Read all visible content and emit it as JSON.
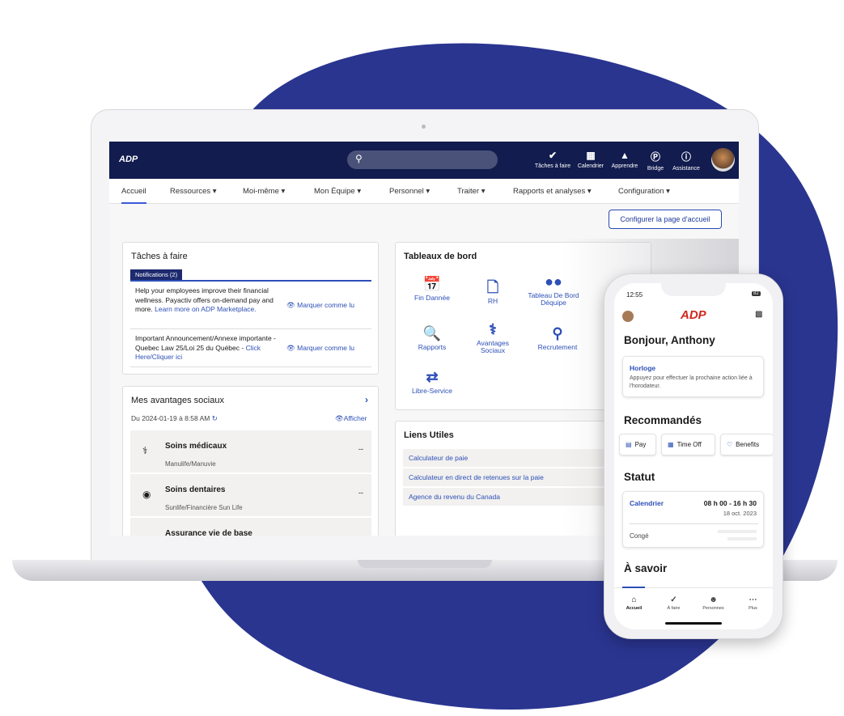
{
  "colors": {
    "brand_blue": "#2a3590",
    "topbar": "#121c4e",
    "link": "#2d4fb7",
    "adp_red": "#d0271d"
  },
  "topbar": {
    "logo": "ADP",
    "search_icon": "search-icon",
    "icons": [
      {
        "label": "Tâches à faire",
        "icon": "check-badge-icon"
      },
      {
        "label": "Calendrier",
        "icon": "calendar-icon"
      },
      {
        "label": "Apprendre",
        "icon": "graduation-cap-icon"
      },
      {
        "label": "Bridge",
        "icon": "bridge-icon"
      },
      {
        "label": "Assistance",
        "icon": "help-bubble-icon"
      }
    ]
  },
  "nav": [
    "Accueil",
    "Ressources ▾",
    "Moi-même ▾",
    "Mon Équipe ▾",
    "Personnel ▾",
    "Traiter ▾",
    "Rapports et analyses ▾",
    "Configuration ▾"
  ],
  "configure_button": "Configurer la page d'accueil",
  "tasks": {
    "title": "Tâches à faire",
    "tab": "Notifications (2)",
    "items": [
      {
        "text": "Help your employees improve their financial wellness. Payactiv offers on-demand pay and more.",
        "link": "Learn more on ADP Marketplace.",
        "action": "Marquer comme lu"
      },
      {
        "text": "Important Announcement/Annexe importante - Quebec Law 25/Loi 25 du Québec -",
        "link": "Click Here/Cliquer ici",
        "action": "Marquer comme lu"
      }
    ]
  },
  "benefits": {
    "title": "Mes avantages sociaux",
    "date": "Du 2024-01-19 à 8:58 AM",
    "view": "Afficher",
    "items": [
      {
        "title": "Soins médicaux",
        "provider": "Manulife/Manuvie",
        "value": "--"
      },
      {
        "title": "Soins dentaires",
        "provider": "Sunlife/Financière Sun Life",
        "value": "--"
      },
      {
        "title": "Assurance vie de base",
        "provider": "",
        "value": ""
      }
    ]
  },
  "dashboards": {
    "title": "Tableaux de bord",
    "tiles": [
      "Fin Dannée",
      "RH",
      "Tableau De Bord Déquipe",
      "Rapports",
      "Avantages Sociaux",
      "Recrutement",
      "Libre-Service"
    ]
  },
  "links": {
    "title": "Liens Utiles",
    "items": [
      "Calculateur de paie",
      "Calculateur en direct de retenues sur la paie",
      "Agence du revenu du Canada"
    ]
  },
  "phone": {
    "time": "12:55",
    "battery": "82",
    "logo": "ADP",
    "greeting": "Bonjour, Anthony",
    "clock": {
      "title": "Horloge",
      "text": "Appuyez pour effectuer la prochaine action liée à l'horodateur."
    },
    "recommended_title": "Recommandés",
    "recommended": [
      "Pay",
      "Time Off",
      "Benefits"
    ],
    "status_title": "Statut",
    "schedule_label": "Calendrier",
    "schedule_time": "08 h 00 - 16 h 30",
    "schedule_date": "18 oct. 2023",
    "leave_label": "Congé",
    "know_title": "À savoir",
    "tabs": [
      "Accueil",
      "À faire",
      "Personnes",
      "Plus"
    ]
  }
}
